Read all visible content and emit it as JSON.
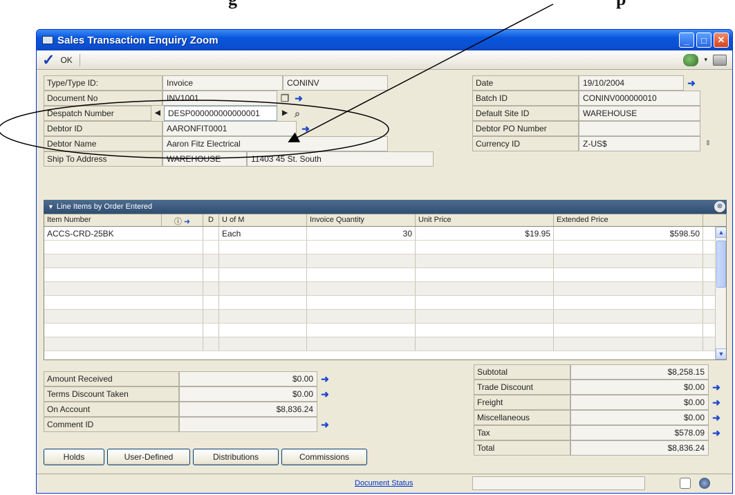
{
  "doc_heading": "g",
  "doc_heading_suffix": "p",
  "window": {
    "title": "Sales Transaction Enquiry Zoom"
  },
  "toolbar": {
    "ok_label": "OK"
  },
  "header_left": {
    "type_label": "Type/Type ID:",
    "type_value": "Invoice",
    "type_id_value": "CONINV",
    "document_no_label": "Document No",
    "document_no_value": "INV1001",
    "despatch_label": "Despatch Number",
    "despatch_value": "DESP000000000000001",
    "debtor_id_label": "Debtor ID",
    "debtor_id_value": "AARONFIT0001",
    "debtor_name_label": "Debtor Name",
    "debtor_name_value": "Aaron Fitz Electrical",
    "ship_to_label": "Ship To Address",
    "ship_to_id": "WAREHOUSE",
    "ship_to_address": "11403 45 St. South"
  },
  "header_right": {
    "date_label": "Date",
    "date_value": "19/10/2004",
    "batch_label": "Batch ID",
    "batch_value": "CONINV000000010",
    "site_label": "Default Site ID",
    "site_value": "WAREHOUSE",
    "po_label": "Debtor PO Number",
    "po_value": "",
    "currency_label": "Currency ID",
    "currency_value": "Z-US$"
  },
  "grid": {
    "title": "Line Items by Order Entered",
    "columns": [
      "Item Number",
      "D",
      "U of M",
      "Invoice Quantity",
      "Unit Price",
      "Extended Price"
    ],
    "rows": [
      {
        "item": "ACCS-CRD-25BK",
        "d": "",
        "uom": "Each",
        "qty": "30",
        "unit_price": "$19.95",
        "extended_price": "$598.50"
      }
    ]
  },
  "totals_left": {
    "amount_received_label": "Amount Received",
    "amount_received_value": "$0.00",
    "terms_discount_label": "Terms Discount Taken",
    "terms_discount_value": "$0.00",
    "on_account_label": "On Account",
    "on_account_value": "$8,836.24",
    "comment_id_label": "Comment ID",
    "comment_id_value": ""
  },
  "totals_right": {
    "subtotal_label": "Subtotal",
    "subtotal_value": "$8,258.15",
    "trade_discount_label": "Trade Discount",
    "trade_discount_value": "$0.00",
    "freight_label": "Freight",
    "freight_value": "$0.00",
    "misc_label": "Miscellaneous",
    "misc_value": "$0.00",
    "tax_label": "Tax",
    "tax_value": "$578.09",
    "total_label": "Total",
    "total_value": "$8,836.24"
  },
  "buttons": {
    "holds": "Holds",
    "user_defined": "User-Defined",
    "distributions": "Distributions",
    "commissions": "Commissions"
  },
  "status": {
    "document_status": "Document Status"
  },
  "colors": {
    "titlebar": "#0b4fd1",
    "arrow": "#1d48d0",
    "grid_title": "#3a5a80"
  }
}
